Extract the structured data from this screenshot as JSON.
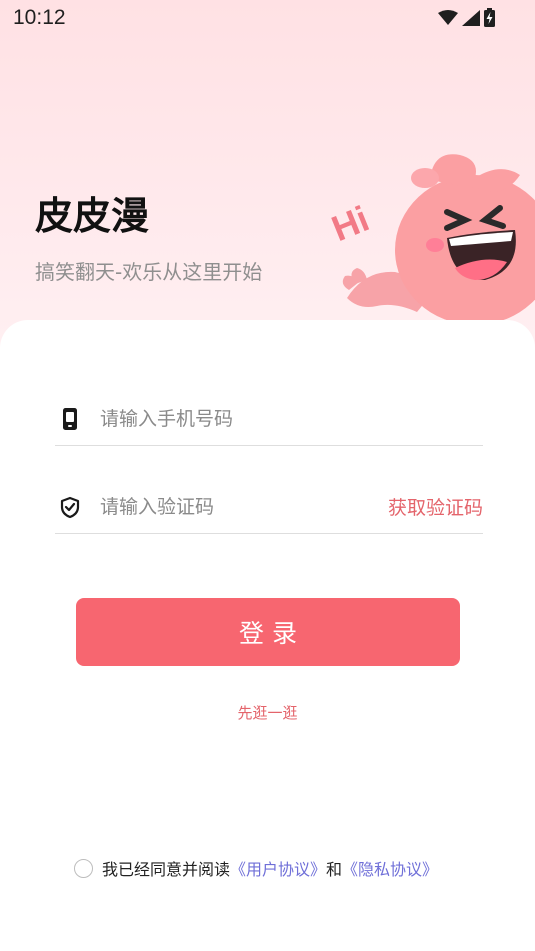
{
  "status_bar": {
    "time": "10:12",
    "icons": [
      "wifi-icon",
      "signal-icon",
      "battery-charging-icon"
    ]
  },
  "header": {
    "title": "皮皮漫",
    "slogan": "搞笑翻天-欢乐从这里开始",
    "mascot_text": "Hi"
  },
  "form": {
    "phone_placeholder": "请输入手机号码",
    "phone_value": "",
    "code_placeholder": "请输入验证码",
    "code_value": "",
    "get_code_label": "获取验证码",
    "phone_icon": "phone-icon",
    "shield_icon": "shield-check-icon"
  },
  "login_button_label": "登录",
  "browse_link": "先逛一逛",
  "agreement": {
    "checked": false,
    "prefix": "我已经同意并阅读",
    "user_agreement": "《用户协议》",
    "and": "和",
    "privacy_policy": "《隐私协议》"
  },
  "colors": {
    "accent": "#f76670",
    "link_red": "#e4646b",
    "link_blue": "#6f6fd8",
    "hero_bg": "#ffe1e4"
  }
}
